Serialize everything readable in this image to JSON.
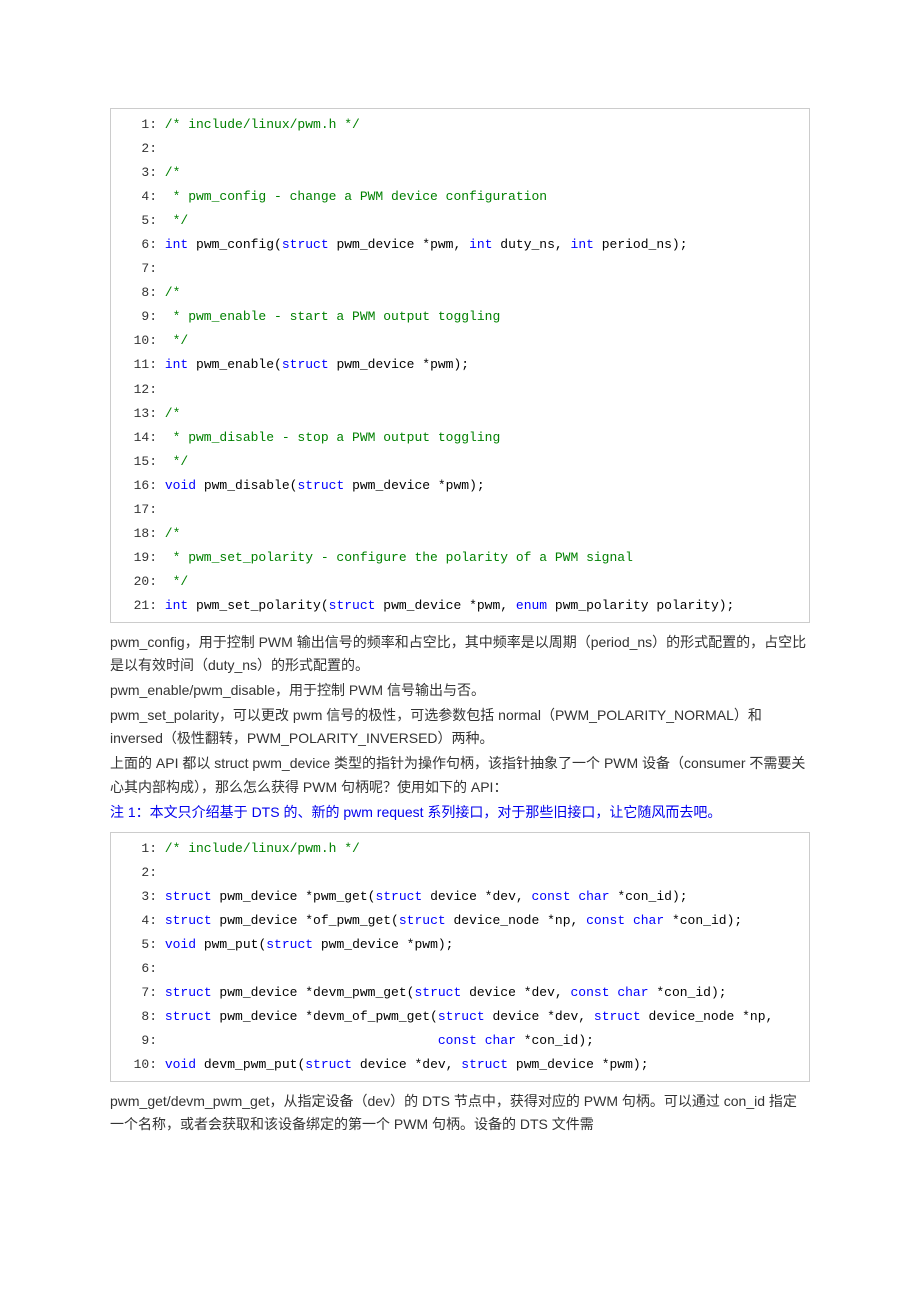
{
  "block1": {
    "lines": [
      {
        "n": " 1:",
        "seg": [
          {
            "c": "cm",
            "t": " /* include/linux/pwm.h */"
          }
        ]
      },
      {
        "n": " 2:",
        "seg": [
          {
            "c": "txt",
            "t": "  "
          }
        ]
      },
      {
        "n": " 3:",
        "seg": [
          {
            "c": "cm",
            "t": " /*"
          }
        ]
      },
      {
        "n": " 4:",
        "seg": [
          {
            "c": "cm",
            "t": "  * pwm_config - change a PWM device configuration"
          }
        ]
      },
      {
        "n": " 5:",
        "seg": [
          {
            "c": "cm",
            "t": "  */"
          }
        ]
      },
      {
        "n": " 6:",
        "seg": [
          {
            "c": "txt",
            "t": " "
          },
          {
            "c": "kw",
            "t": "int"
          },
          {
            "c": "txt",
            "t": " pwm_config("
          },
          {
            "c": "kw",
            "t": "struct"
          },
          {
            "c": "txt",
            "t": " pwm_device *pwm, "
          },
          {
            "c": "kw",
            "t": "int"
          },
          {
            "c": "txt",
            "t": " duty_ns, "
          },
          {
            "c": "kw",
            "t": "int"
          },
          {
            "c": "txt",
            "t": " period_ns);"
          }
        ]
      },
      {
        "n": " 7:",
        "seg": [
          {
            "c": "txt",
            "t": "  "
          }
        ]
      },
      {
        "n": " 8:",
        "seg": [
          {
            "c": "cm",
            "t": " /*"
          }
        ]
      },
      {
        "n": " 9:",
        "seg": [
          {
            "c": "cm",
            "t": "  * pwm_enable - start a PWM output toggling"
          }
        ]
      },
      {
        "n": "10:",
        "seg": [
          {
            "c": "cm",
            "t": "  */"
          }
        ]
      },
      {
        "n": "11:",
        "seg": [
          {
            "c": "txt",
            "t": " "
          },
          {
            "c": "kw",
            "t": "int"
          },
          {
            "c": "txt",
            "t": " pwm_enable("
          },
          {
            "c": "kw",
            "t": "struct"
          },
          {
            "c": "txt",
            "t": " pwm_device *pwm);"
          }
        ]
      },
      {
        "n": "12:",
        "seg": [
          {
            "c": "txt",
            "t": "  "
          }
        ]
      },
      {
        "n": "13:",
        "seg": [
          {
            "c": "cm",
            "t": " /*"
          }
        ]
      },
      {
        "n": "14:",
        "seg": [
          {
            "c": "cm",
            "t": "  * pwm_disable - stop a PWM output toggling"
          }
        ]
      },
      {
        "n": "15:",
        "seg": [
          {
            "c": "cm",
            "t": "  */"
          }
        ]
      },
      {
        "n": "16:",
        "seg": [
          {
            "c": "txt",
            "t": " "
          },
          {
            "c": "kw",
            "t": "void"
          },
          {
            "c": "txt",
            "t": " pwm_disable("
          },
          {
            "c": "kw",
            "t": "struct"
          },
          {
            "c": "txt",
            "t": " pwm_device *pwm);"
          }
        ]
      },
      {
        "n": "17:",
        "seg": [
          {
            "c": "txt",
            "t": "  "
          }
        ]
      },
      {
        "n": "18:",
        "seg": [
          {
            "c": "cm",
            "t": " /*"
          }
        ]
      },
      {
        "n": "19:",
        "seg": [
          {
            "c": "cm",
            "t": "  * pwm_set_polarity - configure the polarity of a PWM signal"
          }
        ]
      },
      {
        "n": "20:",
        "seg": [
          {
            "c": "cm",
            "t": "  */"
          }
        ]
      },
      {
        "n": "21:",
        "seg": [
          {
            "c": "txt",
            "t": " "
          },
          {
            "c": "kw",
            "t": "int"
          },
          {
            "c": "txt",
            "t": " pwm_set_polarity("
          },
          {
            "c": "kw",
            "t": "struct"
          },
          {
            "c": "txt",
            "t": " pwm_device *pwm, "
          },
          {
            "c": "kw",
            "t": "enum"
          },
          {
            "c": "txt",
            "t": " pwm_polarity polarity);"
          }
        ]
      }
    ]
  },
  "para1": "pwm_config，用于控制 PWM 输出信号的频率和占空比，其中频率是以周期（period_ns）的形式配置的，占空比是以有效时间（duty_ns）的形式配置的。",
  "para2": "pwm_enable/pwm_disable，用于控制 PWM 信号输出与否。",
  "para3": "pwm_set_polarity，可以更改 pwm 信号的极性，可选参数包括 normal（PWM_POLARITY_NORMAL）和 inversed（极性翻转，PWM_POLARITY_INVERSED）两种。",
  "para4": "上面的 API 都以 struct pwm_device 类型的指针为操作句柄，该指针抽象了一个 PWM 设备（consumer 不需要关心其内部构成），那么怎么获得 PWM 句柄呢？使用如下的 API：",
  "note1": "注 1：本文只介绍基于 DTS 的、新的 pwm request 系列接口，对于那些旧接口，让它随风而去吧。",
  "block2": {
    "lines": [
      {
        "n": " 1:",
        "seg": [
          {
            "c": "cm",
            "t": " /* include/linux/pwm.h */"
          }
        ]
      },
      {
        "n": " 2:",
        "seg": [
          {
            "c": "txt",
            "t": "  "
          }
        ]
      },
      {
        "n": " 3:",
        "seg": [
          {
            "c": "txt",
            "t": " "
          },
          {
            "c": "kw",
            "t": "struct"
          },
          {
            "c": "txt",
            "t": " pwm_device *pwm_get("
          },
          {
            "c": "kw",
            "t": "struct"
          },
          {
            "c": "txt",
            "t": " device *dev, "
          },
          {
            "c": "kw",
            "t": "const"
          },
          {
            "c": "txt",
            "t": " "
          },
          {
            "c": "kw",
            "t": "char"
          },
          {
            "c": "txt",
            "t": " *con_id);"
          }
        ]
      },
      {
        "n": " 4:",
        "seg": [
          {
            "c": "txt",
            "t": " "
          },
          {
            "c": "kw",
            "t": "struct"
          },
          {
            "c": "txt",
            "t": " pwm_device *of_pwm_get("
          },
          {
            "c": "kw",
            "t": "struct"
          },
          {
            "c": "txt",
            "t": " device_node *np, "
          },
          {
            "c": "kw",
            "t": "const"
          },
          {
            "c": "txt",
            "t": " "
          },
          {
            "c": "kw",
            "t": "char"
          },
          {
            "c": "txt",
            "t": " *con_id);"
          }
        ]
      },
      {
        "n": " 5:",
        "seg": [
          {
            "c": "txt",
            "t": " "
          },
          {
            "c": "kw",
            "t": "void"
          },
          {
            "c": "txt",
            "t": " pwm_put("
          },
          {
            "c": "kw",
            "t": "struct"
          },
          {
            "c": "txt",
            "t": " pwm_device *pwm);"
          }
        ]
      },
      {
        "n": " 6:",
        "seg": [
          {
            "c": "txt",
            "t": "  "
          }
        ]
      },
      {
        "n": " 7:",
        "seg": [
          {
            "c": "txt",
            "t": " "
          },
          {
            "c": "kw",
            "t": "struct"
          },
          {
            "c": "txt",
            "t": " pwm_device *devm_pwm_get("
          },
          {
            "c": "kw",
            "t": "struct"
          },
          {
            "c": "txt",
            "t": " device *dev, "
          },
          {
            "c": "kw",
            "t": "const"
          },
          {
            "c": "txt",
            "t": " "
          },
          {
            "c": "kw",
            "t": "char"
          },
          {
            "c": "txt",
            "t": " *con_id);"
          }
        ]
      },
      {
        "n": " 8:",
        "seg": [
          {
            "c": "txt",
            "t": " "
          },
          {
            "c": "kw",
            "t": "struct"
          },
          {
            "c": "txt",
            "t": " pwm_device *devm_of_pwm_get("
          },
          {
            "c": "kw",
            "t": "struct"
          },
          {
            "c": "txt",
            "t": " device *dev, "
          },
          {
            "c": "kw",
            "t": "struct"
          },
          {
            "c": "txt",
            "t": " device_node *np,"
          }
        ]
      },
      {
        "n": " 9:",
        "seg": [
          {
            "c": "txt",
            "t": "                                    "
          },
          {
            "c": "kw",
            "t": "const"
          },
          {
            "c": "txt",
            "t": " "
          },
          {
            "c": "kw",
            "t": "char"
          },
          {
            "c": "txt",
            "t": " *con_id);"
          }
        ]
      },
      {
        "n": "10:",
        "seg": [
          {
            "c": "txt",
            "t": " "
          },
          {
            "c": "kw",
            "t": "void"
          },
          {
            "c": "txt",
            "t": " devm_pwm_put("
          },
          {
            "c": "kw",
            "t": "struct"
          },
          {
            "c": "txt",
            "t": " device *dev, "
          },
          {
            "c": "kw",
            "t": "struct"
          },
          {
            "c": "txt",
            "t": " pwm_device *pwm);"
          }
        ]
      }
    ]
  },
  "para5": "pwm_get/devm_pwm_get，从指定设备（dev）的 DTS 节点中，获得对应的 PWM 句柄。可以通过 con_id 指定一个名称，或者会获取和该设备绑定的第一个 PWM 句柄。设备的 DTS 文件需"
}
